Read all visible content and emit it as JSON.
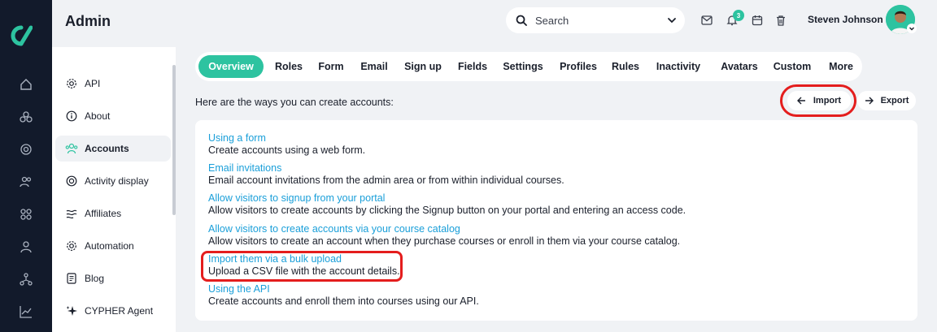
{
  "app": {
    "title": "Admin"
  },
  "header": {
    "search_label": "Search",
    "notification_count": "3",
    "user_name": "Steven Johnson"
  },
  "rail": {
    "icons": [
      "home-icon",
      "courses-icon",
      "target-icon",
      "users-icon",
      "grid-icon",
      "user-icon",
      "network-icon",
      "chart-icon"
    ]
  },
  "sidebar": {
    "items": [
      {
        "label": "API",
        "icon": "gear-icon"
      },
      {
        "label": "About",
        "icon": "info-icon"
      },
      {
        "label": "Accounts",
        "icon": "users-icon",
        "active": true
      },
      {
        "label": "Activity display",
        "icon": "target-icon"
      },
      {
        "label": "Affiliates",
        "icon": "affiliates-icon"
      },
      {
        "label": "Automation",
        "icon": "gear-icon"
      },
      {
        "label": "Blog",
        "icon": "document-icon"
      },
      {
        "label": "CYPHER Agent",
        "icon": "sparkle-icon"
      }
    ]
  },
  "tabs": [
    "Overview",
    "Roles",
    "Form",
    "Email",
    "Sign up",
    "Fields",
    "Settings",
    "Profiles",
    "Rules",
    "Inactivity",
    "Avatars",
    "Custom",
    "More"
  ],
  "active_tab": "Overview",
  "main": {
    "intro": "Here are the ways you can create accounts:",
    "import_label": "Import",
    "export_label": "Export",
    "options": [
      {
        "link": "Using a form",
        "desc": "Create accounts using a web form."
      },
      {
        "link": "Email invitations",
        "desc": "Email account invitations from the admin area or from within individual courses."
      },
      {
        "link": "Allow visitors to signup from your portal",
        "desc": "Allow visitors to create accounts by clicking the Signup button on your portal and entering an access code."
      },
      {
        "link": "Allow visitors to create accounts via your course catalog",
        "desc": "Allow visitors to create an account when they purchase courses or enroll in them via your course catalog."
      },
      {
        "link": "Import them via a bulk upload",
        "desc": "Upload a CSV file with the account details."
      },
      {
        "link": "Using the API",
        "desc": "Create accounts and enroll them into courses using our API."
      }
    ]
  },
  "colors": {
    "accent": "#2dc3a0",
    "rail": "#121a2b",
    "link": "#1a9fd9",
    "highlight": "#e41d1d"
  }
}
